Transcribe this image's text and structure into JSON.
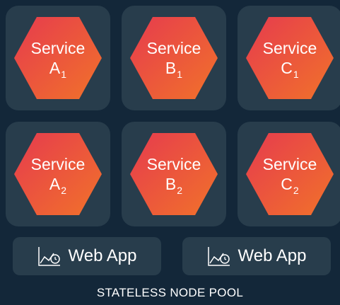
{
  "colors": {
    "background": "#132739",
    "tile": "#283d4c",
    "hex_gradient_start": "#e63b4e",
    "hex_gradient_end": "#f1722a",
    "text": "#ffffff"
  },
  "services": [
    {
      "label": "Service",
      "letter": "A",
      "index": "1"
    },
    {
      "label": "Service",
      "letter": "B",
      "index": "1"
    },
    {
      "label": "Service",
      "letter": "C",
      "index": "1"
    },
    {
      "label": "Service",
      "letter": "A",
      "index": "2"
    },
    {
      "label": "Service",
      "letter": "B",
      "index": "2"
    },
    {
      "label": "Service",
      "letter": "C",
      "index": "2"
    }
  ],
  "web_apps": [
    {
      "label": "Web App",
      "icon": "chart-timer-icon"
    },
    {
      "label": "Web App",
      "icon": "chart-timer-icon"
    }
  ],
  "footer": {
    "label": "STATELESS NODE POOL"
  }
}
